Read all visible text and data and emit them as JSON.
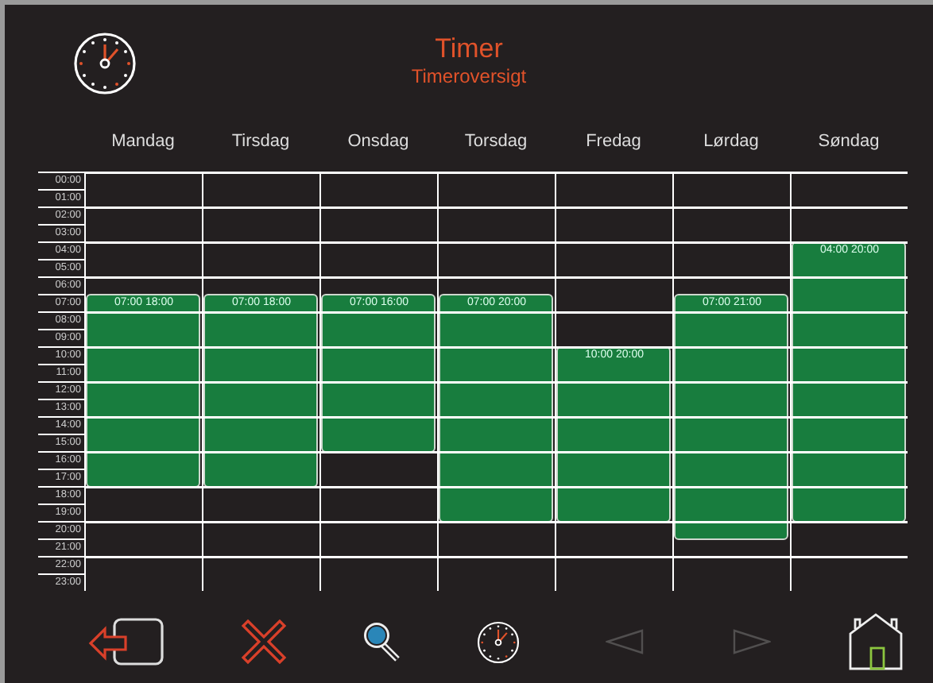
{
  "header": {
    "title": "Timer",
    "subtitle": "Timeroversigt"
  },
  "time_labels": [
    "00:00",
    "01:00",
    "02:00",
    "03:00",
    "04:00",
    "05:00",
    "06:00",
    "07:00",
    "08:00",
    "09:00",
    "10:00",
    "11:00",
    "12:00",
    "13:00",
    "14:00",
    "15:00",
    "16:00",
    "17:00",
    "18:00",
    "19:00",
    "20:00",
    "21:00",
    "22:00",
    "23:00"
  ],
  "days": [
    {
      "name": "Mandag",
      "start": "07:00",
      "end": "18:00"
    },
    {
      "name": "Tirsdag",
      "start": "07:00",
      "end": "18:00"
    },
    {
      "name": "Onsdag",
      "start": "07:00",
      "end": "16:00"
    },
    {
      "name": "Torsdag",
      "start": "07:00",
      "end": "20:00"
    },
    {
      "name": "Fredag",
      "start": "10:00",
      "end": "20:00"
    },
    {
      "name": "Lørdag",
      "start": "07:00",
      "end": "21:00"
    },
    {
      "name": "Søndag",
      "start": "04:00",
      "end": "20:00"
    }
  ],
  "footer_buttons": [
    {
      "kind": "back",
      "disabled": false
    },
    {
      "kind": "delete",
      "disabled": false
    },
    {
      "kind": "search",
      "disabled": false
    },
    {
      "kind": "timer",
      "disabled": false
    },
    {
      "kind": "previous",
      "disabled": true
    },
    {
      "kind": "next",
      "disabled": true
    },
    {
      "kind": "home",
      "disabled": false
    }
  ]
}
